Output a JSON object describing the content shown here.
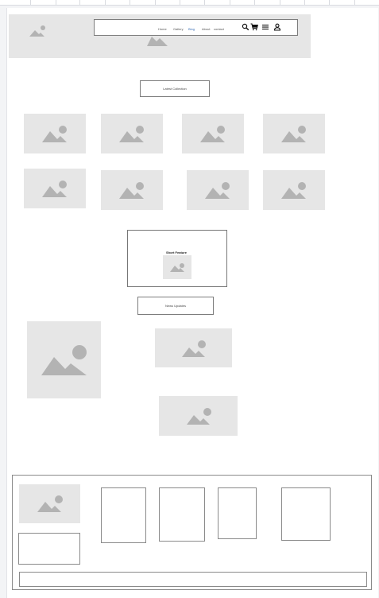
{
  "nav": {
    "links": [
      {
        "label": "Home"
      },
      {
        "label": "Gallery"
      },
      {
        "label": "Blog"
      },
      {
        "label": "About"
      },
      {
        "label": "contact"
      }
    ],
    "icons": [
      "search-icon",
      "cart-icon",
      "menu-icon",
      "user-icon"
    ]
  },
  "sections": {
    "latest_collection": "Latest Collection",
    "short_feature": "Short Feature",
    "news_updates": "News Updates"
  },
  "colors": {
    "placeholder_bg": "#e6e6e6",
    "placeholder_icon": "#b3b3b3",
    "border": "#8a8a8a",
    "active_link": "#3b6fb6"
  }
}
